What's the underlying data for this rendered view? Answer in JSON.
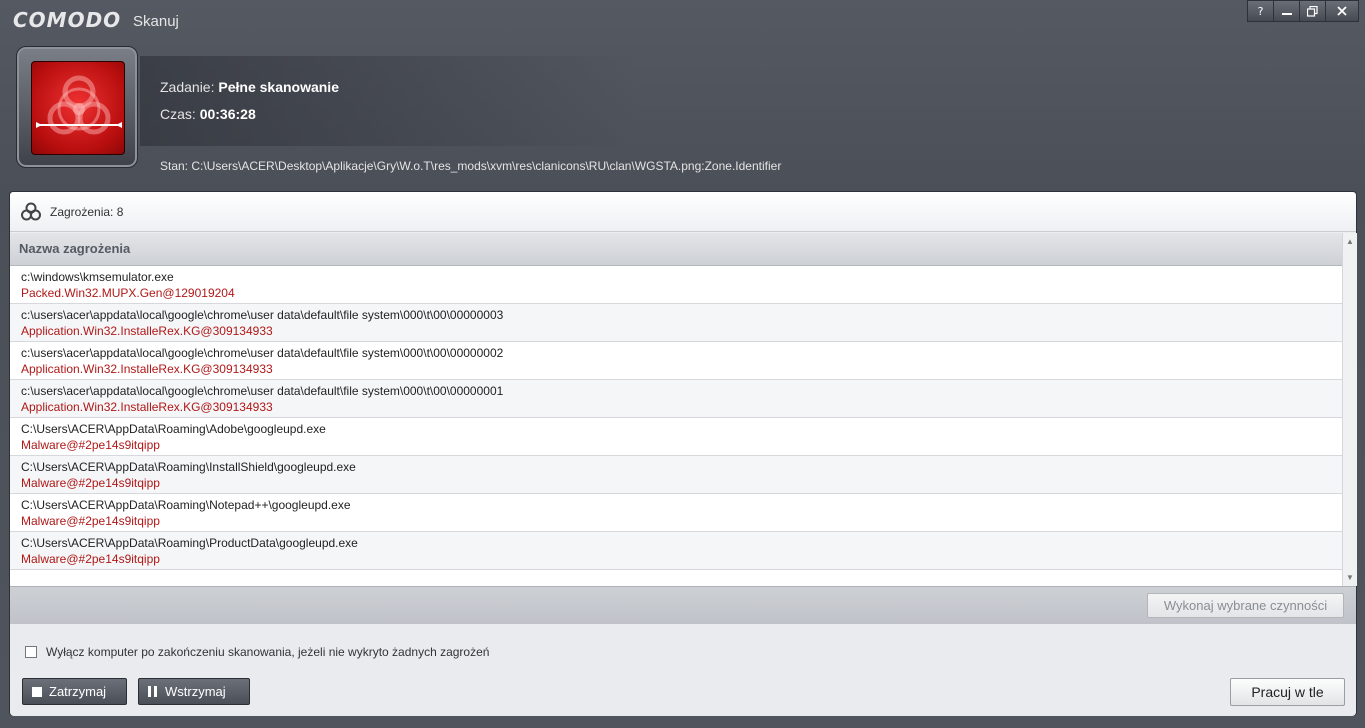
{
  "window": {
    "brand": "COMODO",
    "title": "Skanuj",
    "controls": {
      "help": "?",
      "minimize": "–",
      "restore": "⧉",
      "close": "✕"
    }
  },
  "header": {
    "task_label": "Zadanie:",
    "task_value": "Pełne skanowanie",
    "time_label": "Czas:",
    "time_value": "00:36:28",
    "status_text": "Stan: C:\\Users\\ACER\\Desktop\\Aplikacje\\Gry\\W.o.T\\res_mods\\xvm\\res\\clanicons\\RU\\clan\\WGSTA.png:Zone.Identifier",
    "icon": "biohazard-icon",
    "icon_color": "#d81e1e"
  },
  "threats": {
    "count_label": "Zagrożenia: 8",
    "column_header": "Nazwa zagrożenia",
    "rows": [
      {
        "path": "c:\\windows\\kmsemulator.exe",
        "threat": "Packed.Win32.MUPX.Gen@129019204"
      },
      {
        "path": "c:\\users\\acer\\appdata\\local\\google\\chrome\\user data\\default\\file system\\000\\t\\00\\00000003",
        "threat": "Application.Win32.InstalleRex.KG@309134933"
      },
      {
        "path": "c:\\users\\acer\\appdata\\local\\google\\chrome\\user data\\default\\file system\\000\\t\\00\\00000002",
        "threat": "Application.Win32.InstalleRex.KG@309134933"
      },
      {
        "path": "c:\\users\\acer\\appdata\\local\\google\\chrome\\user data\\default\\file system\\000\\t\\00\\00000001",
        "threat": "Application.Win32.InstalleRex.KG@309134933"
      },
      {
        "path": "C:\\Users\\ACER\\AppData\\Roaming\\Adobe\\googleupd.exe",
        "threat": "Malware@#2pe14s9itqipp"
      },
      {
        "path": "C:\\Users\\ACER\\AppData\\Roaming\\InstallShield\\googleupd.exe",
        "threat": "Malware@#2pe14s9itqipp"
      },
      {
        "path": "C:\\Users\\ACER\\AppData\\Roaming\\Notepad++\\googleupd.exe",
        "threat": "Malware@#2pe14s9itqipp"
      },
      {
        "path": "C:\\Users\\ACER\\AppData\\Roaming\\ProductData\\googleupd.exe",
        "threat": "Malware@#2pe14s9itqipp"
      }
    ],
    "threat_color": "#b01818"
  },
  "actions": {
    "apply_label": "Wykonaj wybrane czynności"
  },
  "footer": {
    "shutdown_label": "Wyłącz komputer po zakończeniu skanowania, jeżeli nie wykryto żadnych zagrożeń",
    "shutdown_checked": false,
    "stop_label": "Zatrzymaj",
    "pause_label": "Wstrzymaj",
    "background_label": "Pracuj w tle"
  }
}
